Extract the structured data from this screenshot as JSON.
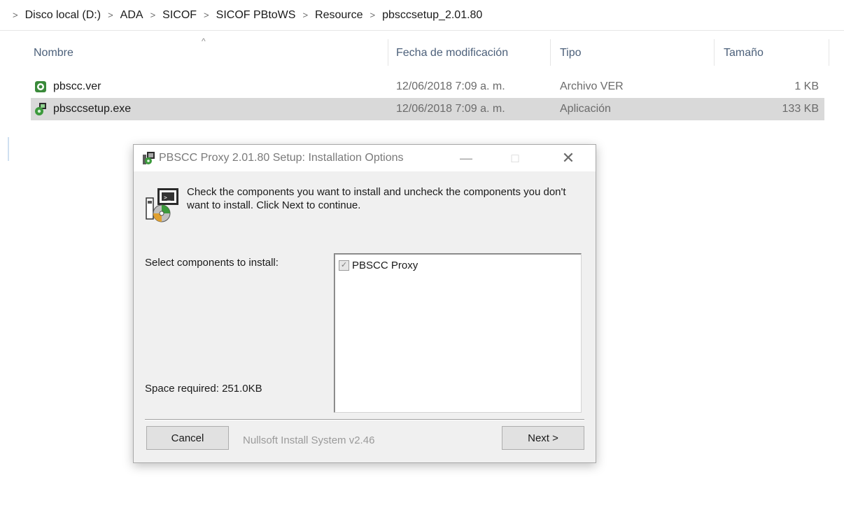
{
  "breadcrumb": {
    "items": [
      "Disco local (D:)",
      "ADA",
      "SICOF",
      "SICOF PBtoWS",
      "Resource",
      "pbsccsetup_2.01.80"
    ],
    "separator": ">"
  },
  "file_list": {
    "columns": {
      "name": "Nombre",
      "date": "Fecha de modificación",
      "type": "Tipo",
      "size": "Tamaño"
    },
    "sort_indicator": "^",
    "rows": [
      {
        "name": "pbscc.ver",
        "date": "12/06/2018 7:09 a. m.",
        "type": "Archivo VER",
        "size": "1 KB",
        "selected": false
      },
      {
        "name": "pbsccsetup.exe",
        "date": "12/06/2018 7:09 a. m.",
        "type": "Aplicación",
        "size": "133 KB",
        "selected": true
      }
    ]
  },
  "dialog": {
    "title": "PBSCC Proxy 2.01.80 Setup: Installation Options",
    "header_text": "Check the components you want to install and uncheck the components you don't want to install. Click Next to continue.",
    "select_label": "Select components to install:",
    "space_required": "Space required: 251.0KB",
    "components": [
      {
        "label": "PBSCC Proxy",
        "checked": true
      }
    ],
    "branding": "Nullsoft Install System v2.46",
    "cancel_label": "Cancel",
    "next_label": "Next >",
    "window_buttons": {
      "minimize": "—",
      "maximize": "□",
      "close": "✕"
    }
  },
  "colors": {
    "selected_row": "#d9d9d9",
    "column_header": "#4c607a",
    "dialog_bg": "#f0f0f0",
    "button_bg": "#e1e1e1"
  }
}
